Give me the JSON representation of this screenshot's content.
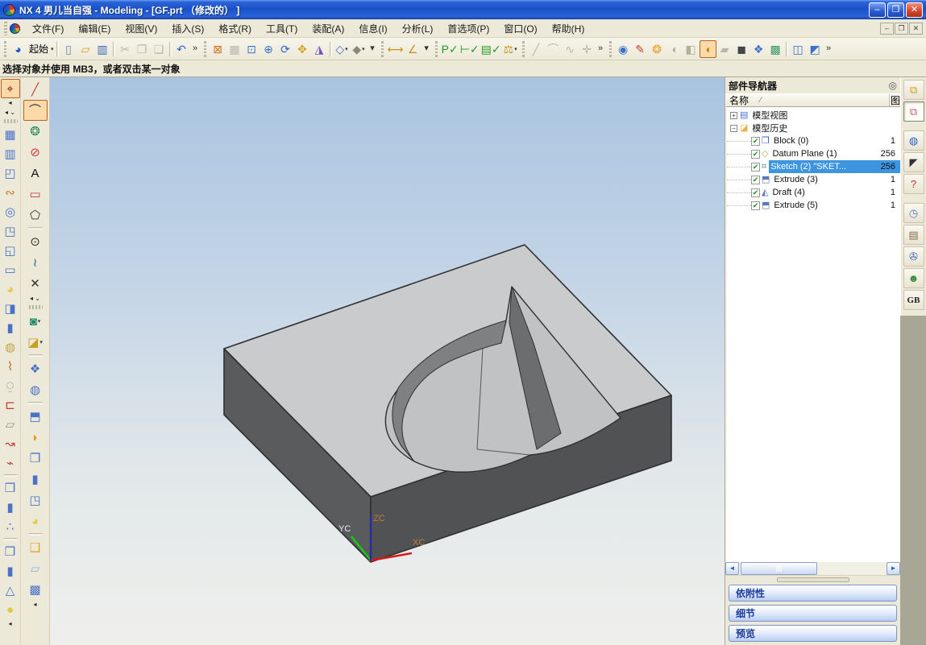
{
  "window": {
    "title": "NX 4 男儿当自强 - Modeling - [GF.prt （修改的） ]",
    "controls": {
      "minimize": "–",
      "restore": "❐",
      "close": "✕"
    }
  },
  "menu_bar": {
    "items": [
      {
        "n": "menu-file",
        "label": "文件(F)"
      },
      {
        "n": "menu-edit",
        "label": "编辑(E)"
      },
      {
        "n": "menu-view",
        "label": "视图(V)"
      },
      {
        "n": "menu-insert",
        "label": "插入(S)"
      },
      {
        "n": "menu-format",
        "label": "格式(R)"
      },
      {
        "n": "menu-tools",
        "label": "工具(T)"
      },
      {
        "n": "menu-assemblies",
        "label": "装配(A)"
      },
      {
        "n": "menu-information",
        "label": "信息(I)"
      },
      {
        "n": "menu-analysis",
        "label": "分析(L)"
      },
      {
        "n": "menu-preferences",
        "label": "首选项(P)"
      },
      {
        "n": "menu-window",
        "label": "窗口(O)"
      },
      {
        "n": "menu-help",
        "label": "帮助(H)"
      }
    ],
    "mdi": {
      "minimize": "–",
      "restore": "❐",
      "close": "✕"
    }
  },
  "toolbar": {
    "items": [
      {
        "t": "grip"
      },
      {
        "n": "nx-app-icon",
        "g": "◕",
        "c": "#1a54c8"
      },
      {
        "n": "start-menu-button",
        "t": "label",
        "label": "起始",
        "arrow": "▾"
      },
      {
        "t": "sep"
      },
      {
        "n": "new-file-button",
        "g": "▯",
        "c": "#6a82aa"
      },
      {
        "n": "open-file-button",
        "g": "▱",
        "c": "#d8a020"
      },
      {
        "n": "save-button",
        "g": "▥",
        "c": "#3a62b8"
      },
      {
        "t": "sep"
      },
      {
        "n": "cut-button",
        "g": "✂",
        "c": "#888",
        "s": "disabled"
      },
      {
        "n": "copy-button",
        "g": "❐",
        "c": "#888",
        "s": "disabled"
      },
      {
        "n": "paste-button",
        "g": "❏",
        "c": "#888",
        "s": "disabled"
      },
      {
        "t": "sep"
      },
      {
        "n": "undo-button",
        "g": "↶",
        "c": "#2b62c8"
      },
      {
        "n": "standard-overflow-button",
        "t": "overflow",
        "g": "»"
      },
      {
        "t": "grip"
      },
      {
        "n": "fit-view-button",
        "g": "⊠",
        "c": "#d07020"
      },
      {
        "n": "refresh-view-button",
        "g": "▦",
        "c": "#9a9a8a",
        "s": "disabled"
      },
      {
        "n": "zoom-box-button",
        "g": "⊡",
        "c": "#3a72c8"
      },
      {
        "n": "zoom-in-out-button",
        "g": "⊕",
        "c": "#3a72c8"
      },
      {
        "n": "rotate-view-button",
        "g": "⟳",
        "c": "#2b62c8"
      },
      {
        "n": "pan-view-button",
        "g": "✥",
        "c": "#d8a020"
      },
      {
        "n": "perspective-button",
        "g": "◮",
        "c": "#7a4ac8"
      },
      {
        "t": "sep"
      },
      {
        "n": "wireframe-display-button",
        "g": "◇",
        "c": "#3a72c8",
        "arrow": "▾"
      },
      {
        "n": "shaded-display-button",
        "g": "◆",
        "c": "#8a8a7a",
        "arrow": "▾"
      },
      {
        "n": "view-overflow-button",
        "t": "overflow",
        "g": "▾"
      },
      {
        "t": "grip"
      },
      {
        "n": "measure-distance-button",
        "g": "⟷",
        "c": "#c8941a"
      },
      {
        "n": "measure-angle-button",
        "g": "∠",
        "c": "#c8941a"
      },
      {
        "n": "measure-overflow-button",
        "t": "overflow",
        "g": "▾"
      },
      {
        "t": "grip"
      },
      {
        "n": "expression-check-icon",
        "g": "P✓",
        "c": "#249a24"
      },
      {
        "n": "dimension-check-icon",
        "g": "⊢✓",
        "c": "#249a24"
      },
      {
        "n": "sheet-check-icon",
        "g": "▤✓",
        "c": "#249a24"
      },
      {
        "n": "balance-scale-icon",
        "g": "⚖",
        "c": "#c8941a",
        "arrow": "▾"
      },
      {
        "t": "grip"
      },
      {
        "n": "line-tool-button",
        "g": "╱",
        "c": "#888",
        "s": "disabled"
      },
      {
        "n": "arc-tool-button",
        "g": "⌒",
        "c": "#888",
        "s": "disabled"
      },
      {
        "n": "spline-tool-button",
        "g": "∿",
        "c": "#888",
        "s": "disabled"
      },
      {
        "n": "axis-tool-button",
        "g": "✛",
        "c": "#888",
        "s": "disabled"
      },
      {
        "n": "curve-overflow-button",
        "t": "overflow",
        "g": "»"
      },
      {
        "t": "grip"
      },
      {
        "n": "camera-view-icon",
        "g": "◉",
        "c": "#3a72c8"
      },
      {
        "n": "artistic-render-icon",
        "g": "✎",
        "c": "#c83a3a"
      },
      {
        "n": "color-ball-icon",
        "g": "❂",
        "c": "#e8a020"
      },
      {
        "n": "spotlight-icon",
        "g": "◖",
        "c": "#b0b0a0"
      },
      {
        "n": "spotlight-list-icon",
        "g": "◧",
        "c": "#b0b098"
      },
      {
        "n": "sketch-task-button",
        "g": "◖",
        "c": "#b8860a",
        "s": "active"
      },
      {
        "n": "rock-sample-icon",
        "g": "▰",
        "c": "#9a9a8a",
        "s": "disabled"
      },
      {
        "n": "material-cube-icon",
        "g": "◼",
        "c": "#44464a"
      },
      {
        "n": "texture-cube-icon",
        "g": "❖",
        "c": "#3a72c8"
      },
      {
        "n": "scene-cube-icon",
        "g": "▩",
        "c": "#3a9a6a"
      },
      {
        "t": "sep"
      },
      {
        "n": "share-window-icon",
        "g": "◫",
        "c": "#3a72c8"
      },
      {
        "n": "user-session-icon",
        "g": "◩",
        "c": "#3a72c8"
      },
      {
        "n": "render-overflow-button",
        "t": "overflow",
        "g": "»"
      }
    ]
  },
  "prompt_bar": {
    "text": "选择对象并使用 MB3，或者双击某一对象"
  },
  "left_toolbar_primary": {
    "items": [
      {
        "n": "snap-point-button",
        "g": "⌖",
        "c": "#7a2020",
        "s": "active"
      },
      {
        "n": "snap-options-arrow",
        "t": "mini",
        "g": "◂"
      },
      {
        "n": "toolbar-collapse-arrows",
        "t": "mini",
        "g": "◂ ⌄"
      },
      {
        "t": "grip"
      },
      {
        "n": "view-layout-button",
        "g": "▦",
        "c": "#4a72c8"
      },
      {
        "n": "instance-array-button",
        "g": "▥",
        "c": "#4a72c8"
      },
      {
        "n": "boss-button",
        "g": "◰",
        "c": "#4a72c8"
      },
      {
        "n": "sweep-button",
        "g": "∾",
        "c": "#c87a2a"
      },
      {
        "n": "hole-button",
        "g": "◎",
        "c": "#4a72c8"
      },
      {
        "n": "pocket-button",
        "g": "◳",
        "c": "#4a72c8"
      },
      {
        "n": "pad-button",
        "g": "◱",
        "c": "#4a72c8"
      },
      {
        "n": "slot-button",
        "g": "▭",
        "c": "#4a72c8"
      },
      {
        "n": "dome-button",
        "g": "◕",
        "c": "#e8c84a"
      },
      {
        "n": "emboss-button",
        "g": "◨",
        "c": "#4a72c8"
      },
      {
        "n": "boss-cylinder-button",
        "g": "▮",
        "c": "#4a72c8"
      },
      {
        "n": "shell-button",
        "g": "◍",
        "c": "#c8a04a"
      },
      {
        "n": "thread-button",
        "g": "⌇",
        "c": "#c86a2a"
      },
      {
        "n": "stamp-button",
        "g": "⍜",
        "c": "#8a8a7a"
      },
      {
        "n": "clamp-button",
        "g": "⊏",
        "c": "#c83a3a"
      },
      {
        "n": "note-button",
        "g": "▱",
        "c": "#9a9a8a"
      },
      {
        "n": "bend-button",
        "g": "↝",
        "c": "#c83a3a"
      },
      {
        "n": "spline-point-button",
        "g": "⌁",
        "c": "#c83a3a"
      },
      {
        "t": "sep"
      },
      {
        "n": "body-button",
        "g": "❒",
        "c": "#4a72c8"
      },
      {
        "n": "cylinder-body-button",
        "g": "▮",
        "c": "#4a72c8"
      },
      {
        "n": "point-set-button",
        "g": "∴",
        "c": "#8a4ac8"
      },
      {
        "t": "sep"
      },
      {
        "n": "block-button",
        "g": "❒",
        "c": "#4a72c8"
      },
      {
        "n": "cylinder-button",
        "g": "▮",
        "c": "#4a72c8"
      },
      {
        "n": "cone-button",
        "g": "△",
        "c": "#4a72c8"
      },
      {
        "n": "sphere-button",
        "g": "●",
        "c": "#e0cc3a"
      },
      {
        "n": "primary-more-arrow",
        "t": "mini",
        "g": "◂"
      }
    ]
  },
  "left_toolbar_sketch": {
    "items": [
      {
        "n": "sketch-line-button",
        "g": "╱",
        "c": "#c83a3a"
      },
      {
        "n": "sketch-arc-button",
        "g": "⌒",
        "c": "#333333",
        "s": "active"
      },
      {
        "n": "sketch-profile-button",
        "g": "❂",
        "c": "#2a8a5a"
      },
      {
        "n": "sketch-derived-line-button",
        "g": "⊘",
        "c": "#c83a3a"
      },
      {
        "n": "sketch-text-button",
        "g": "A",
        "c": "#111111"
      },
      {
        "n": "sketch-rectangle-button",
        "g": "▭",
        "c": "#c83a3a"
      },
      {
        "n": "sketch-polygon-button",
        "g": "⬠",
        "c": "#333333"
      },
      {
        "t": "sep"
      },
      {
        "n": "sketch-ellipse-button",
        "g": "⊙",
        "c": "#333333"
      },
      {
        "n": "sketch-conic-button",
        "g": "≀",
        "c": "#2a6a8a"
      },
      {
        "n": "sketch-intersect-button",
        "g": "✕",
        "c": "#333333"
      },
      {
        "n": "sketch-collapse-arrows",
        "t": "mini",
        "g": "◂ ⌄"
      },
      {
        "t": "grip"
      },
      {
        "n": "unite-button",
        "g": "◙",
        "c": "#1f8a6a",
        "arrow": "▾"
      },
      {
        "n": "trim-body-button",
        "g": "◪",
        "c": "#c8a020",
        "arrow": "▾"
      },
      {
        "t": "sep"
      },
      {
        "n": "offset-surface-button",
        "g": "❖",
        "c": "#4a72c8"
      },
      {
        "n": "sphere-surface-button",
        "g": "◍",
        "c": "#4a72c8"
      },
      {
        "t": "sep"
      },
      {
        "n": "extrude-button",
        "g": "⬒",
        "c": "#4a72c8"
      },
      {
        "n": "revolve-button",
        "g": "◗",
        "c": "#e8a020"
      },
      {
        "n": "sheet-box-button",
        "g": "❐",
        "c": "#4a72c8"
      },
      {
        "n": "tube-button",
        "g": "▮",
        "c": "#4a72c8"
      },
      {
        "n": "cube-hole-button",
        "g": "◳",
        "c": "#4a72c8"
      },
      {
        "n": "pool-button",
        "g": "◕",
        "c": "#e8c84a"
      },
      {
        "t": "sep"
      },
      {
        "n": "pad-sheet-button",
        "g": "❑",
        "c": "#e8a020"
      },
      {
        "n": "sheet-body-button",
        "g": "▱",
        "c": "#9ab0d8"
      },
      {
        "n": "pattern-cube-button",
        "g": "▩",
        "c": "#4a72c8"
      },
      {
        "n": "sketch-more-arrow",
        "t": "mini",
        "g": "◂"
      }
    ]
  },
  "viewport": {
    "background_top": "#a9c4e0",
    "background_bottom": "#efefec",
    "triad": {
      "x_label": "XC",
      "y_label": "YC",
      "z_label": "ZC",
      "x_color": "#e01414",
      "y_color": "#18c818",
      "z_color": "#2222e6",
      "xz_label_color": "#c87830",
      "y_label_color": "#e8e8e8"
    },
    "model": {
      "top_face": "#c9cbcc",
      "left_face": "#595b5d",
      "right_face": "#505254",
      "pocket_floor": "#c0c2c3",
      "pocket_wall_dark": "#6b6d6f",
      "pocket_wall_mid": "#7e8082",
      "edge": "#2e3032"
    }
  },
  "part_navigator": {
    "title": "部件导航器",
    "pin_glyph": "◎",
    "columns": {
      "name": "名称",
      "sort_indicator": "∕",
      "layer": "图"
    },
    "tree": [
      {
        "n": "tree-item-model-views",
        "indent": 0,
        "expander": "+",
        "g": "▤",
        "c": "#4a6fd0",
        "label": "模型视图"
      },
      {
        "n": "tree-item-model-history",
        "indent": 0,
        "expander": "−",
        "g": "◪",
        "c": "#e8b34a",
        "label": "模型历史"
      },
      {
        "n": "tree-item-block",
        "indent": 1,
        "check": "✔",
        "g": "❒",
        "c": "#3a62c8",
        "label": "Block (0)",
        "layer": "1"
      },
      {
        "n": "tree-item-datum-plane",
        "indent": 1,
        "check": "✔",
        "g": "◇",
        "c": "#c8a04a",
        "label": "Datum Plane (1)",
        "layer": "256"
      },
      {
        "n": "tree-item-sketch",
        "indent": 1,
        "check": "✔",
        "g": "⌗",
        "c": "#3a8a8a",
        "label": "Sketch (2) \"SKET...",
        "layer": "256",
        "selected": true
      },
      {
        "n": "tree-item-extrude-3",
        "indent": 1,
        "check": "✔",
        "g": "⬒",
        "c": "#5a7ab8",
        "label": "Extrude (3)",
        "layer": "1"
      },
      {
        "n": "tree-item-draft",
        "indent": 1,
        "check": "✔",
        "g": "◭",
        "c": "#5a7ab8",
        "label": "Draft (4)",
        "layer": "1"
      },
      {
        "n": "tree-item-extrude-5",
        "indent": 1,
        "check": "✔",
        "g": "⬒",
        "c": "#5a7ab8",
        "label": "Extrude (5)",
        "layer": "1"
      }
    ],
    "scrollbar": {
      "left_arrow": "◄",
      "right_arrow": "►"
    },
    "panels": [
      {
        "n": "dependencies-panel",
        "label": "依附性"
      },
      {
        "n": "details-panel",
        "label": "细节"
      },
      {
        "n": "preview-panel",
        "label": "预览"
      }
    ]
  },
  "resource_bar": {
    "items": [
      {
        "n": "assembly-navigator-tab",
        "g": "⧉",
        "c": "#c8a020"
      },
      {
        "n": "part-navigator-tab",
        "g": "⧉",
        "c": "#c85a8a",
        "s": "active"
      },
      {
        "t": "gap"
      },
      {
        "n": "web-browser-tab",
        "g": "◍",
        "c": "#2b62c8"
      },
      {
        "n": "training-tab",
        "g": "◤",
        "c": "#333333"
      },
      {
        "n": "help-tab",
        "g": "?",
        "c": "#b8352a"
      },
      {
        "t": "gap"
      },
      {
        "n": "history-palette-tab",
        "g": "◷",
        "c": "#5a7ac8"
      },
      {
        "n": "system-palettes-tab",
        "g": "▤",
        "c": "#8a6a4a"
      },
      {
        "n": "visualization-tools-tab",
        "g": "✇",
        "c": "#3a62b8"
      },
      {
        "n": "roles-tab",
        "g": "☻",
        "c": "#3a8a3a"
      },
      {
        "n": "gb-standards-tab",
        "t": "label",
        "label": "GB"
      }
    ]
  }
}
